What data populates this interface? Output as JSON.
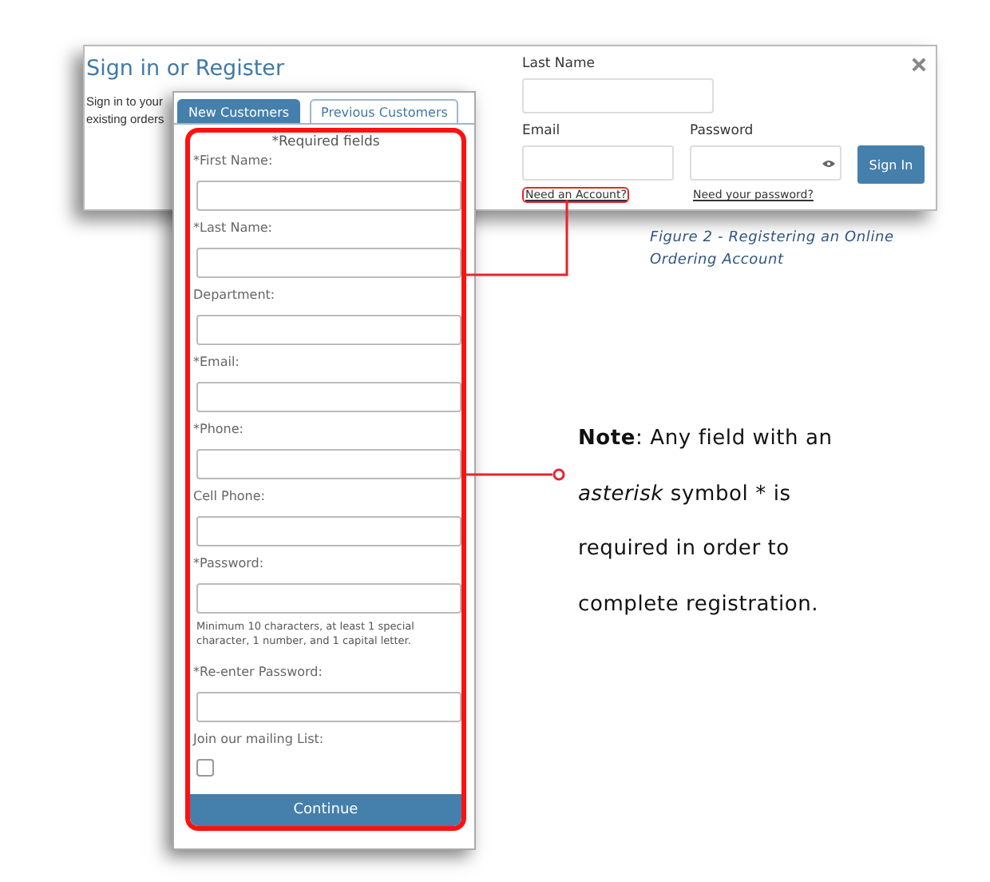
{
  "signin_dialog": {
    "title": "Sign in or Register",
    "intro_lines": [
      "Sign in to your",
      "existing orders"
    ],
    "last_name": {
      "label": "Last Name"
    },
    "email": {
      "label": "Email",
      "link": "Need an Account?"
    },
    "password": {
      "label": "Password",
      "link": "Need your password?"
    },
    "button": "Sign In"
  },
  "registration_form": {
    "tabs": [
      {
        "label": "New Customers",
        "selected": true
      },
      {
        "label": "Previous Customers",
        "selected": false
      }
    ],
    "required_note": "*Required fields",
    "fields": [
      {
        "kind": "text",
        "label": "*First Name:"
      },
      {
        "kind": "text",
        "label": "*Last Name:"
      },
      {
        "kind": "text",
        "label": "Department:"
      },
      {
        "kind": "text",
        "label": "*Email:"
      },
      {
        "kind": "text",
        "label": "*Phone:"
      },
      {
        "kind": "text",
        "label": "Cell Phone:"
      },
      {
        "kind": "text",
        "label": "*Password:",
        "hint": "Minimum 10 characters, at least 1 special character, 1 number, and 1 capital letter."
      },
      {
        "kind": "text",
        "label": "*Re-enter Password:"
      },
      {
        "kind": "checkbox",
        "label": "Join our mailing List:",
        "checked": false
      }
    ],
    "button": "Continue"
  },
  "caption": [
    "Figure 2 - Registering an Online",
    "Ordering Account"
  ],
  "note": "**Note**: Any field with an *asterisk* symbol * is required in order to complete registration."
}
